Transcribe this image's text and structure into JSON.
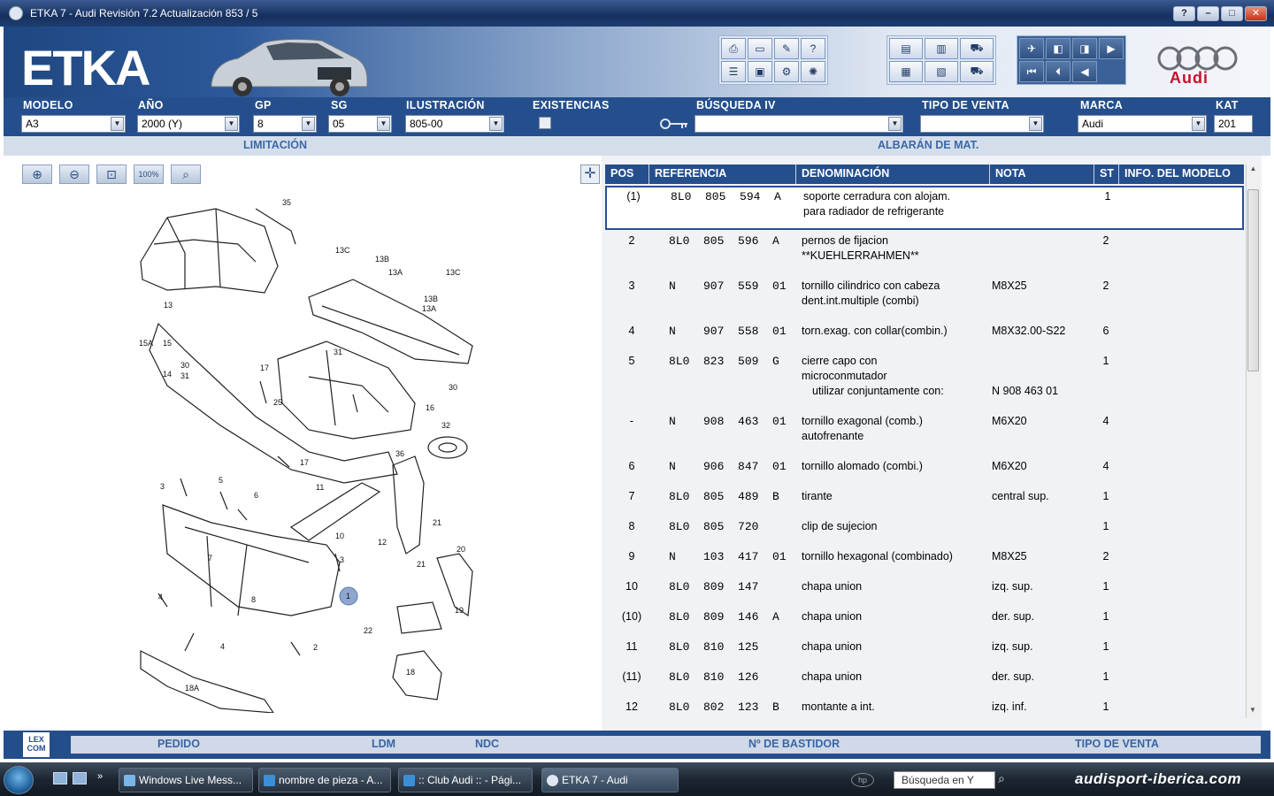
{
  "window": {
    "title": "ETKA 7 - Audi Revisión 7.2 Actualización 853 / 5"
  },
  "header": {
    "logo": "ETKA",
    "brand": "Audi"
  },
  "filters": {
    "modelo": {
      "label": "MODELO",
      "value": "A3"
    },
    "ano": {
      "label": "AÑO",
      "value": "2000 (Y)"
    },
    "gp": {
      "label": "GP",
      "value": "8"
    },
    "sg": {
      "label": "SG",
      "value": "05"
    },
    "ilustracion": {
      "label": "ILUSTRACIÓN",
      "value": "805-00"
    },
    "existencias": {
      "label": "EXISTENCIAS"
    },
    "busqueda": {
      "label": "BÚSQUEDA IV",
      "value": ""
    },
    "tipo_venta": {
      "label": "TIPO DE VENTA",
      "value": ""
    },
    "marca": {
      "label": "MARCA",
      "value": "Audi"
    },
    "kat": {
      "label": "KAT",
      "value": "201"
    }
  },
  "subheader": {
    "left": "LIMITACIÓN",
    "right": "ALBARÁN DE MAT."
  },
  "zoom": {
    "btn4": "100%"
  },
  "table": {
    "headers": [
      "POS",
      "REFERENCIA",
      "DENOMINACIÓN",
      "NOTA",
      "ST",
      "INFO. DEL MODELO"
    ],
    "rows": [
      {
        "pos": "(1)",
        "ref": "8L0  805  594  A",
        "den": "soporte cerradura con alojam.",
        "den2": "para radiador de refrigerante",
        "nota": "",
        "st": "1"
      },
      {
        "pos": "2",
        "ref": "8L0  805  596  A",
        "den": "pernos de fijacion",
        "den2": "**KUEHLERRAHMEN**",
        "nota": "",
        "st": "2"
      },
      {
        "pos": "3",
        "ref": "N    907  559  01",
        "den": "tornillo cilindrico con cabeza",
        "den2": "dent.int.multiple (combi)",
        "nota": "M8X25",
        "st": "2"
      },
      {
        "pos": "4",
        "ref": "N    907  558  01",
        "den": "torn.exag. con collar(combin.)",
        "den2": "",
        "nota": "M8X32.00-S22",
        "st": "6"
      },
      {
        "pos": "5",
        "ref": "8L0  823  509  G",
        "den": "cierre capo con",
        "den2": "microconmutador",
        "den3": "utilizar conjuntamente con:",
        "nota": "",
        "nota3": "N   908 463 01",
        "st": "1"
      },
      {
        "pos": "-",
        "ref": "N    908  463  01",
        "den": "tornillo exagonal (comb.)",
        "den2": "autofrenante",
        "nota": "M6X20",
        "st": "4"
      },
      {
        "pos": "6",
        "ref": "N    906  847  01",
        "den": "tornillo alomado (combi.)",
        "den2": "",
        "nota": "M6X20",
        "st": "4"
      },
      {
        "pos": "7",
        "ref": "8L0  805  489  B",
        "den": "tirante",
        "den2": "",
        "nota": "central sup.",
        "st": "1"
      },
      {
        "pos": "8",
        "ref": "8L0  805  720",
        "den": "clip de sujecion",
        "den2": "",
        "nota": "",
        "st": "1"
      },
      {
        "pos": "9",
        "ref": "N    103  417  01",
        "den": "tornillo hexagonal (combinado)",
        "den2": "",
        "nota": "M8X25",
        "st": "2"
      },
      {
        "pos": "10",
        "ref": "8L0  809  147",
        "den": "chapa union",
        "den2": "",
        "nota": "izq. sup.",
        "st": "1"
      },
      {
        "pos": "(10)",
        "ref": "8L0  809  146  A",
        "den": "chapa union",
        "den2": "",
        "nota": "der. sup.",
        "st": "1"
      },
      {
        "pos": "11",
        "ref": "8L0  810  125",
        "den": "chapa union",
        "den2": "",
        "nota": "izq. sup.",
        "st": "1"
      },
      {
        "pos": "(11)",
        "ref": "8L0  810  126",
        "den": "chapa union",
        "den2": "",
        "nota": "der. sup.",
        "st": "1"
      },
      {
        "pos": "12",
        "ref": "8L0  802  123  B",
        "den": "montante a int.",
        "den2": "",
        "nota": "izq. inf.",
        "st": "1"
      }
    ]
  },
  "bottombar": {
    "lexcom": "LEX COM",
    "pedido": "PEDIDO",
    "ldm": "LDM",
    "ndc": "NDC",
    "bastidor": "Nº DE BASTIDOR",
    "tipo_venta": "TIPO DE VENTA"
  },
  "taskbar": {
    "tasks": [
      "Windows Live Mess...",
      "nombre de pieza - A...",
      ":: Club Audi :: - Pági...",
      "ETKA 7 - Audi"
    ],
    "search_placeholder": "Búsqueda en Y",
    "tray": "audisport-iberica.com"
  },
  "diagram_labels": [
    "35",
    "13C",
    "13B",
    "13A",
    "13C",
    "13B",
    "13A",
    "13",
    "15A",
    "15",
    "31",
    "30",
    "31",
    "14",
    "17",
    "25",
    "16",
    "30",
    "17",
    "32",
    "36",
    "3",
    "5",
    "11",
    "6",
    "10",
    "21",
    "12",
    "20",
    "3",
    "21",
    "1",
    "7",
    "4",
    "8",
    "19",
    "22",
    "4",
    "2",
    "18",
    "18A"
  ]
}
